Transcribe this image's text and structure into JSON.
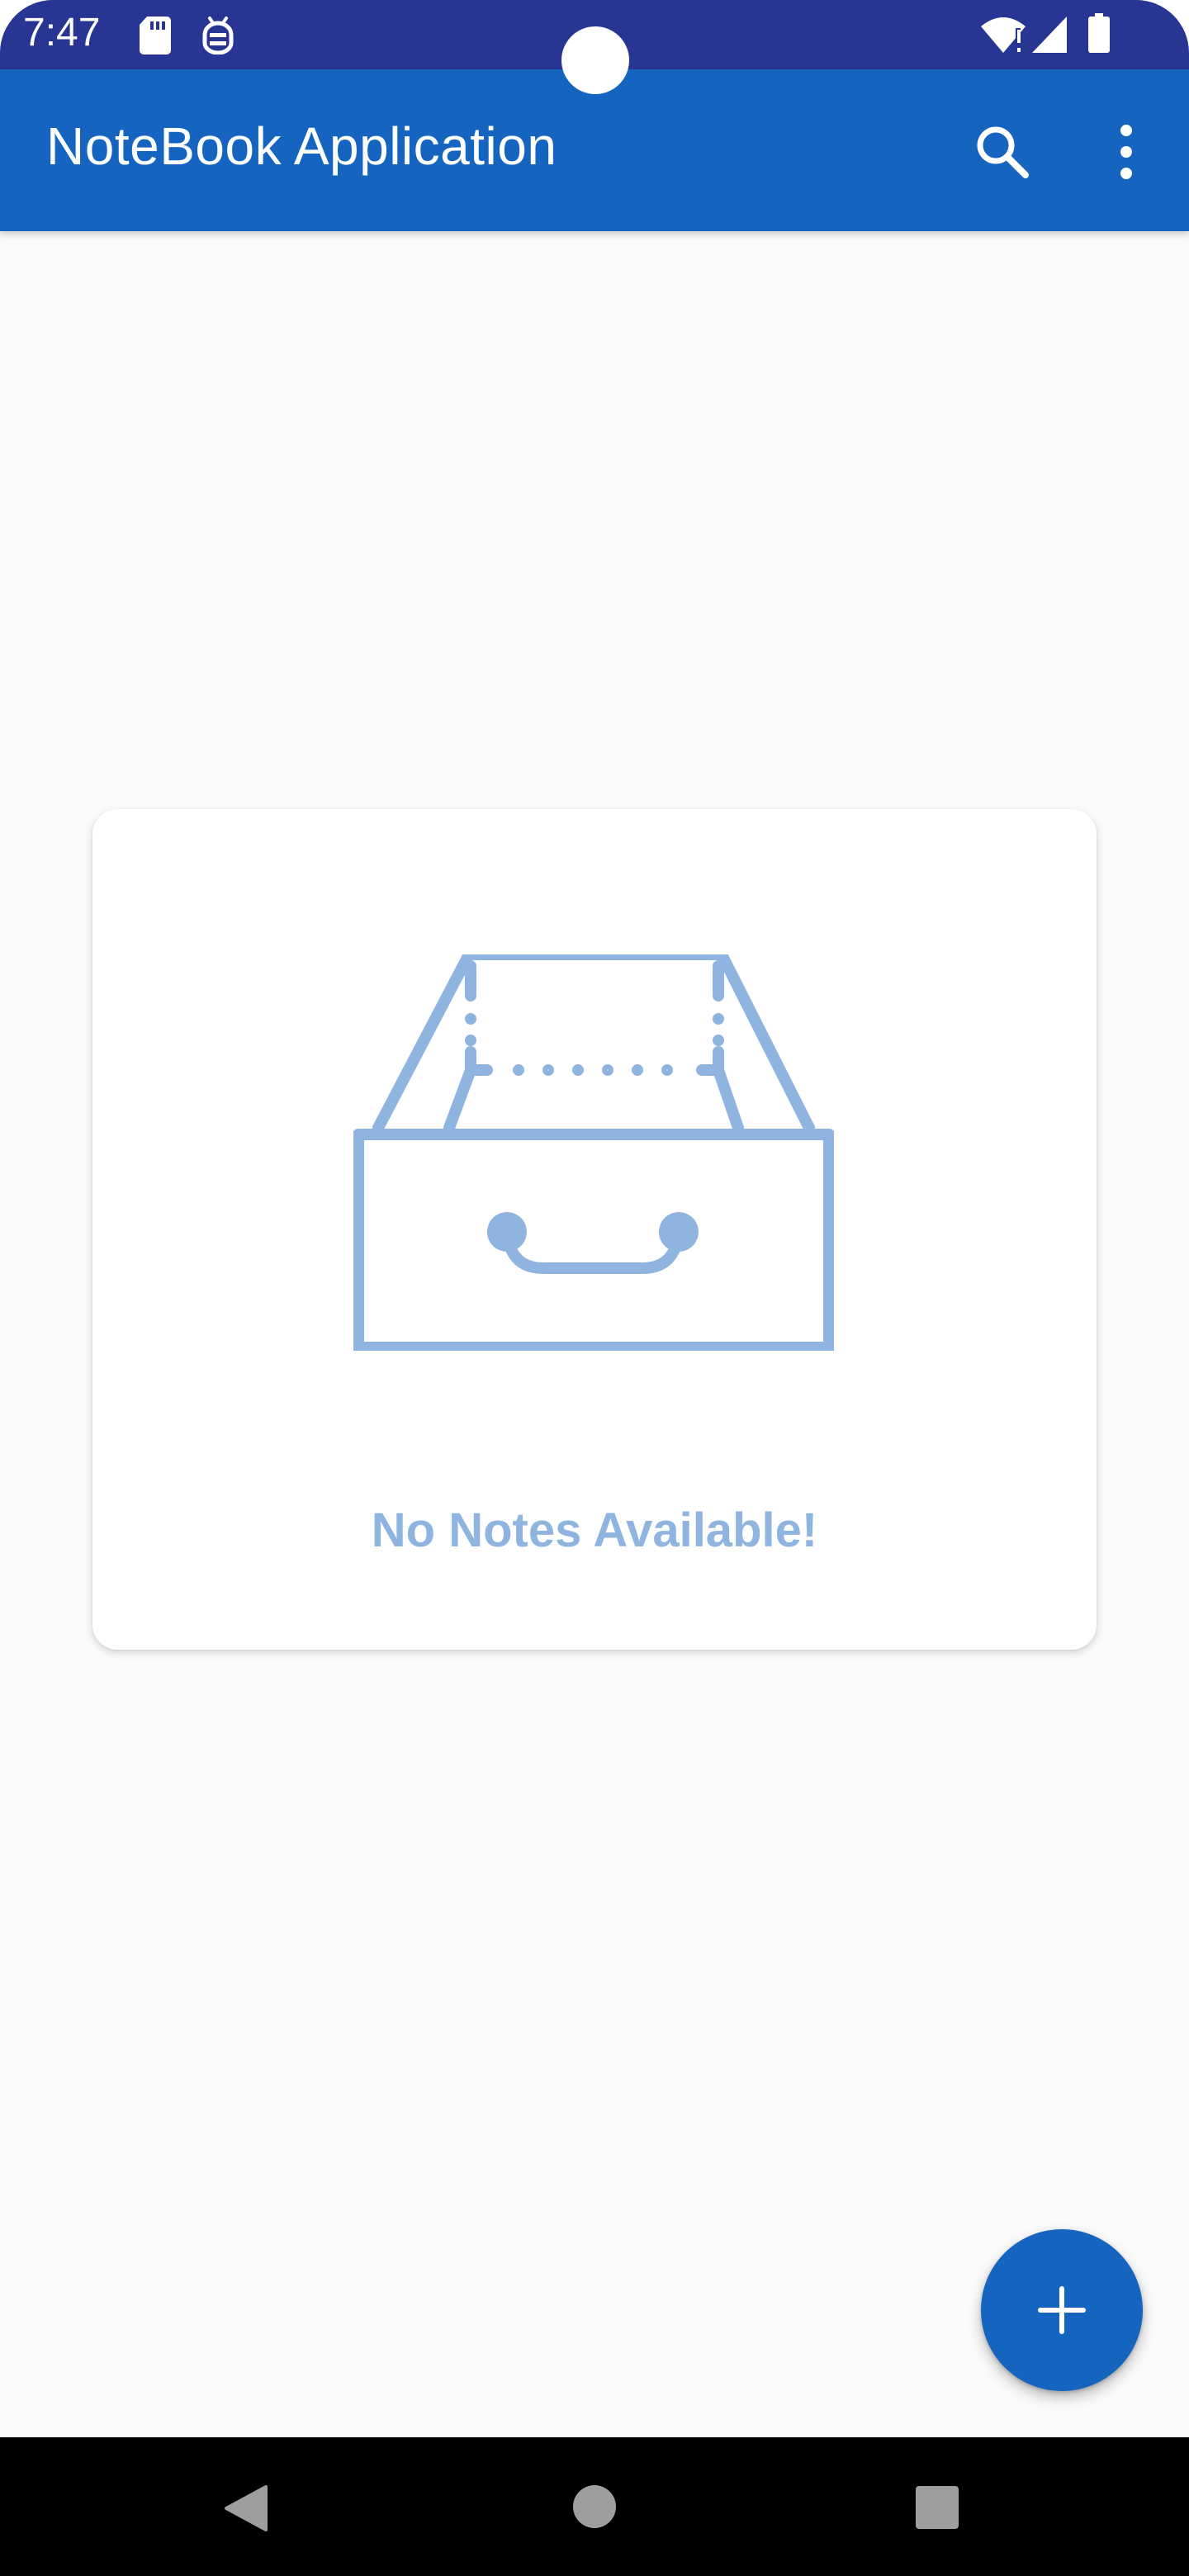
{
  "status_bar": {
    "time": "7:47",
    "icons": [
      "sd-card-icon",
      "debug-icon",
      "wifi-icon",
      "signal-icon",
      "battery-icon"
    ],
    "background_color": "#283593"
  },
  "app_bar": {
    "title": "NoteBook Application",
    "background_color": "#1565c0",
    "actions": [
      "search-icon",
      "more-vert-icon"
    ]
  },
  "empty_state": {
    "icon": "empty-drawer-icon",
    "message": "No Notes Available!",
    "accent_color": "#8fb4e0"
  },
  "fab": {
    "icon": "plus-icon",
    "color": "#1565c0"
  },
  "navigation_bar": {
    "buttons": [
      "back-icon",
      "home-icon",
      "recents-icon"
    ]
  }
}
